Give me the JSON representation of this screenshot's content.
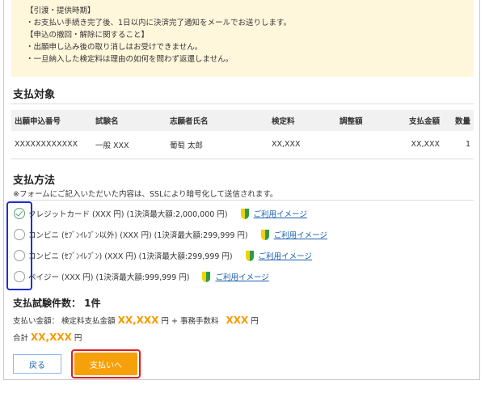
{
  "notice": {
    "lines": [
      "【引渡・提供時期】",
      "・お支払い手続き完了後、1日以内に決済完了通知をメールでお送りします。",
      "【申込の撤回・解除に関すること】",
      "・出願申し込み後の取り消しはお受けできません。",
      "・一旦納入した検定料は理由の如何を問わず返還しません。"
    ]
  },
  "payment_target": {
    "title": "支払対象",
    "headers": [
      "出願申込番号",
      "試験名",
      "志願者氏名",
      "検定料",
      "調整額",
      "支払金額",
      "数量"
    ],
    "row": [
      "XXXXXXXXXXXX",
      "一般 XXX",
      "葡萄 太郎",
      "XX,XXX",
      "",
      "XX,XXX",
      "1"
    ]
  },
  "payment_method": {
    "title": "支払方法",
    "note": "※フォームにご記入いただいた内容は、SSLにより暗号化して送信されます。",
    "options": [
      {
        "label": "クレジットカード (XXX 円) (1決済最大額:2,000,000 円)",
        "link": "ご利用イメージ",
        "checked": true
      },
      {
        "label": "コンビニ (ｾﾌﾞﾝｲﾚﾌﾞﾝ以外) (XXX 円) (1決済最大額:299,999 円)",
        "link": "ご利用イメージ",
        "checked": false
      },
      {
        "label": "コンビニ (ｾﾌﾞﾝｲﾚﾌﾞﾝ) (XXX 円) (1決済最大額:299,999 円)",
        "link": "ご利用イメージ",
        "checked": false
      },
      {
        "label": "ペイジー (XXX 円) (1決済最大額:999,999 円)",
        "link": "ご利用イメージ",
        "checked": false
      }
    ]
  },
  "summary": {
    "count": "支払試験件数： 1件",
    "amount_prefix": "支払い金額： 検定料支払金額",
    "exam_fee": "XX,XXX",
    "unit": "円",
    "plus_fee": "+ 事務手数料",
    "service_fee": "XXX",
    "total_label": "合計",
    "total": "XX,XXX"
  },
  "buttons": {
    "back": "戻る",
    "pay": "支払いへ"
  }
}
